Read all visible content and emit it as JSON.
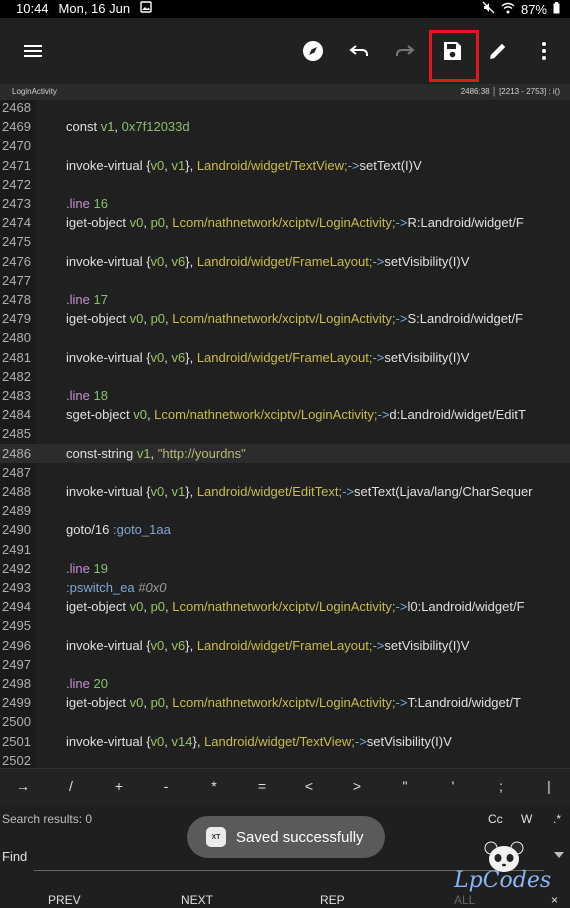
{
  "status_bar": {
    "time": "10:44",
    "date": "Mon, 16 Jun",
    "battery": "87%"
  },
  "toolbar": {
    "icons": [
      "menu-icon",
      "compass-icon",
      "undo-icon",
      "redo-icon",
      "save-icon",
      "edit-icon",
      "more-vert-icon"
    ]
  },
  "subbar": {
    "title": "LoginActivity",
    "position": "2486:38 │ [2213 - 2753] : i()"
  },
  "editor": {
    "current_line": "2486",
    "lines": [
      {
        "n": "2468",
        "t": ""
      },
      {
        "n": "2469",
        "t": "const v1, 0x7f12033d"
      },
      {
        "n": "2470",
        "t": ""
      },
      {
        "n": "2471",
        "t": "invoke-virtual {v0, v1}, Landroid/widget/TextView;->setText(I)V"
      },
      {
        "n": "2472",
        "t": ""
      },
      {
        "n": "2473",
        "t": ".line 16"
      },
      {
        "n": "2474",
        "t": "iget-object v0, p0, Lcom/nathnetwork/xciptv/LoginActivity;->R:Landroid/widget/F"
      },
      {
        "n": "2475",
        "t": ""
      },
      {
        "n": "2476",
        "t": "invoke-virtual {v0, v6}, Landroid/widget/FrameLayout;->setVisibility(I)V"
      },
      {
        "n": "2477",
        "t": ""
      },
      {
        "n": "2478",
        "t": ".line 17"
      },
      {
        "n": "2479",
        "t": "iget-object v0, p0, Lcom/nathnetwork/xciptv/LoginActivity;->S:Landroid/widget/F"
      },
      {
        "n": "2480",
        "t": ""
      },
      {
        "n": "2481",
        "t": "invoke-virtual {v0, v6}, Landroid/widget/FrameLayout;->setVisibility(I)V"
      },
      {
        "n": "2482",
        "t": ""
      },
      {
        "n": "2483",
        "t": ".line 18"
      },
      {
        "n": "2484",
        "t": "sget-object v0, Lcom/nathnetwork/xciptv/LoginActivity;->d:Landroid/widget/EditT"
      },
      {
        "n": "2485",
        "t": ""
      },
      {
        "n": "2486",
        "t": "const-string v1, \"http://yourdns\""
      },
      {
        "n": "2487",
        "t": ""
      },
      {
        "n": "2488",
        "t": "invoke-virtual {v0, v1}, Landroid/widget/EditText;->setText(Ljava/lang/CharSequer"
      },
      {
        "n": "2489",
        "t": ""
      },
      {
        "n": "2490",
        "t": "goto/16 :goto_1aa"
      },
      {
        "n": "2491",
        "t": ""
      },
      {
        "n": "2492",
        "t": ".line 19"
      },
      {
        "n": "2493",
        "t": ":pswitch_ea  #0x0"
      },
      {
        "n": "2494",
        "t": "iget-object v0, p0, Lcom/nathnetwork/xciptv/LoginActivity;->l0:Landroid/widget/F"
      },
      {
        "n": "2495",
        "t": ""
      },
      {
        "n": "2496",
        "t": "invoke-virtual {v0, v6}, Landroid/widget/FrameLayout;->setVisibility(I)V"
      },
      {
        "n": "2497",
        "t": ""
      },
      {
        "n": "2498",
        "t": ".line 20"
      },
      {
        "n": "2499",
        "t": "iget-object v0, p0, Lcom/nathnetwork/xciptv/LoginActivity;->T:Landroid/widget/T"
      },
      {
        "n": "2500",
        "t": ""
      },
      {
        "n": "2501",
        "t": "invoke-virtual {v0, v14}, Landroid/widget/TextView;->setVisibility(I)V"
      },
      {
        "n": "2502",
        "t": ""
      }
    ]
  },
  "symbols": [
    "→",
    "/",
    "+",
    "-",
    "*",
    "=",
    "<",
    ">",
    "\"",
    "'",
    ";",
    "|"
  ],
  "search": {
    "results": "Search results: 0",
    "options": [
      "Cc",
      "W",
      ".*"
    ],
    "find_label": "Find",
    "find_value": "",
    "actions": [
      "PREV",
      "NEXT",
      "REP",
      "ALL",
      "×"
    ]
  },
  "toast": {
    "message": "Saved successfully",
    "icon": "app-icon"
  },
  "watermark": {
    "text": "LpCodes"
  }
}
